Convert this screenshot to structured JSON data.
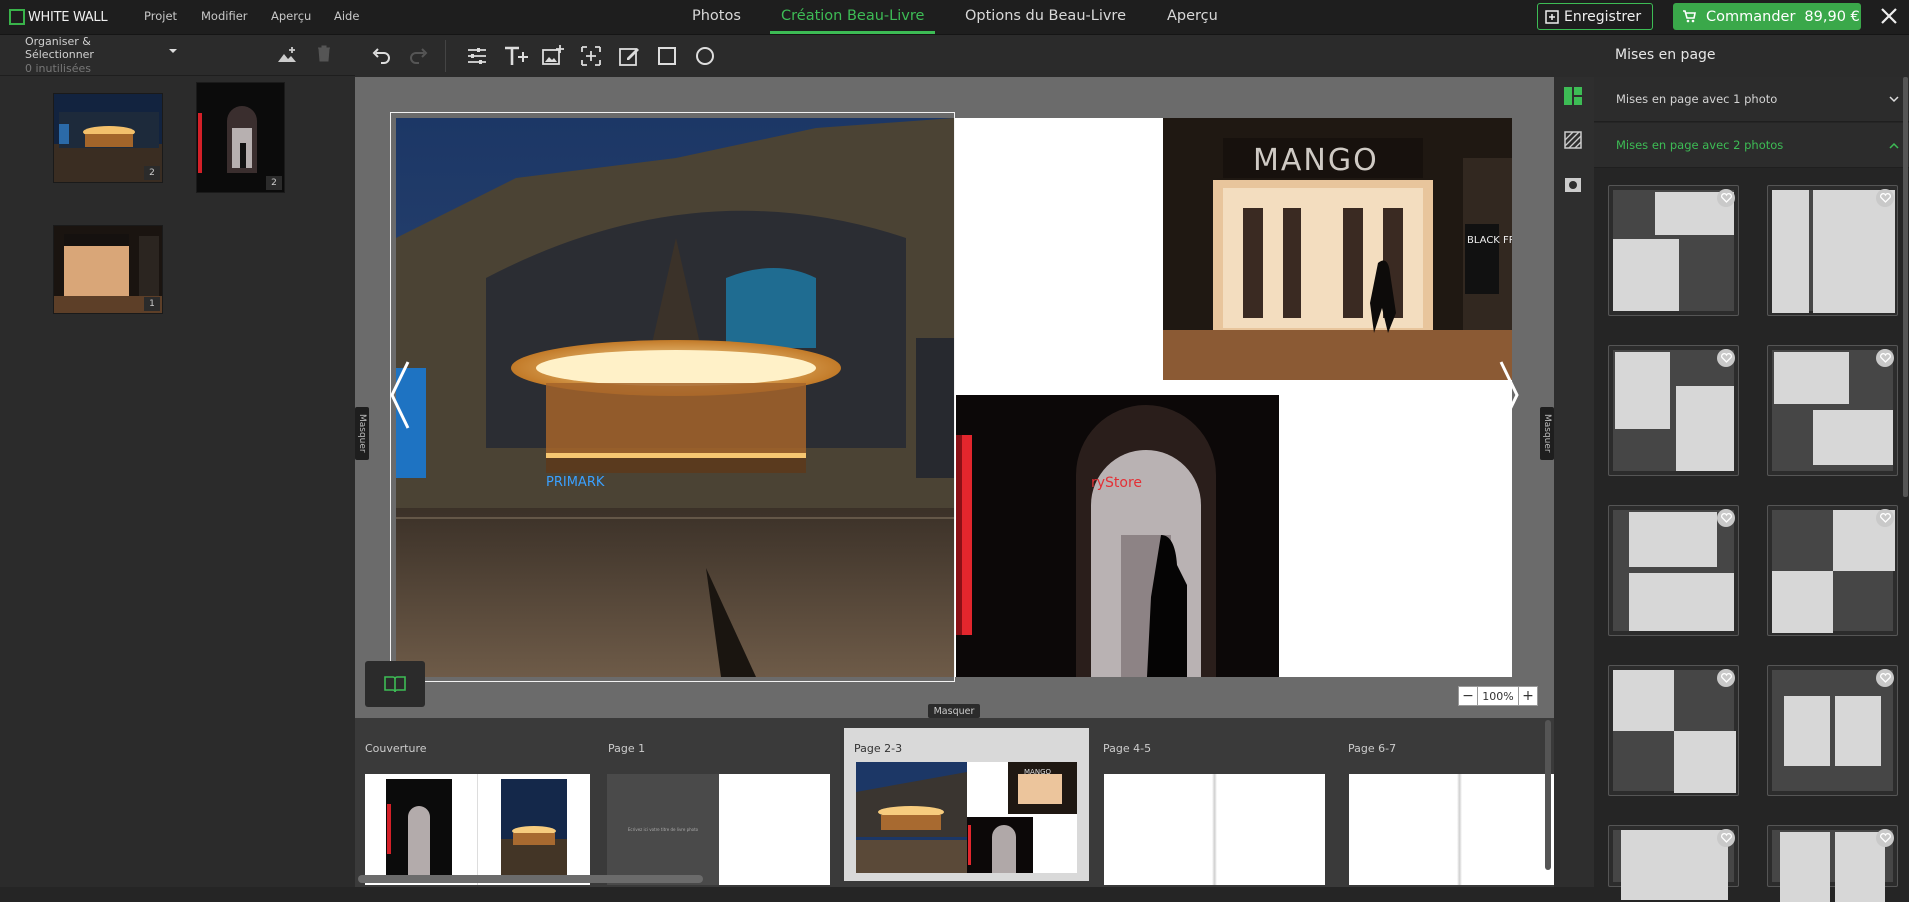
{
  "app": {
    "brand": "WHITE WALL"
  },
  "menu": [
    "Projet",
    "Modifier",
    "Aperçu",
    "Aide"
  ],
  "tabs": [
    "Photos",
    "Création Beau-Livre",
    "Options du Beau-Livre",
    "Aperçu"
  ],
  "active_tab": "Création Beau-Livre",
  "actions": {
    "save": "Enregistrer",
    "order": "Commander",
    "price": "89,90 €"
  },
  "left": {
    "title": "Organiser & Sélectionner",
    "subtitle": "0 inutilisées",
    "photos": [
      {
        "subject": "carousel",
        "count": "2"
      },
      {
        "subject": "red-arch",
        "count": "2"
      },
      {
        "subject": "mango-store",
        "count": "1"
      }
    ]
  },
  "toolbar": {
    "icons": [
      "undo-icon",
      "redo-icon",
      "sliders-icon",
      "add-text-icon",
      "add-image-icon",
      "add-frame-icon",
      "edit-frame-icon",
      "square-icon",
      "circle-icon"
    ]
  },
  "canvas": {
    "masquer_left": "Masquer",
    "masquer_right": "Masquer",
    "masquer_bottom": "Masquer",
    "zoom": "100%",
    "store_sign": "MANGO",
    "shop_sign": "BLACK FRIDAY",
    "carousel_sign": "PRIMARK",
    "arch_sign": "ryStore"
  },
  "pages": [
    {
      "label": "Couverture"
    },
    {
      "label": "Page 1",
      "text": "Ecrivez ici votre titre de livre photo"
    },
    {
      "label": "Page 2-3"
    },
    {
      "label": "Page 4-5"
    },
    {
      "label": "Page 6-7"
    }
  ],
  "right": {
    "title": "Mises en page",
    "section1": "Mises en page avec 1 photo",
    "section2": "Mises en page avec 2 photos",
    "accent": "#3dbc55"
  }
}
